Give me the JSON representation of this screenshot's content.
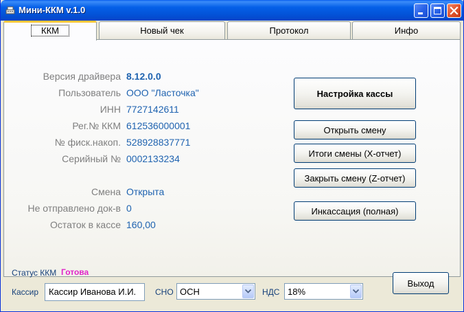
{
  "window": {
    "title": "Мини-ККМ v.1.0"
  },
  "tabs": [
    {
      "label": "ККМ",
      "active": true
    },
    {
      "label": "Новый чек",
      "active": false
    },
    {
      "label": "Протокол",
      "active": false
    },
    {
      "label": "Инфо",
      "active": false
    }
  ],
  "kkm": {
    "driver_version": {
      "label": "Версия драйвера",
      "value": "8.12.0.0"
    },
    "user": {
      "label": "Пользователь",
      "value": "ООО \"Ласточка\""
    },
    "inn": {
      "label": "ИНН",
      "value": "7727142611"
    },
    "reg_number": {
      "label": "Рег.№ ККМ",
      "value": "612536000001"
    },
    "fiscal_number": {
      "label": "№ фиск.накоп.",
      "value": "528928837771"
    },
    "serial_number": {
      "label": "Серийный №",
      "value": "0002133234"
    },
    "shift": {
      "label": "Смена",
      "value": "Открыта"
    },
    "unsent_docs": {
      "label": "Не отправлено док-в",
      "value": "0"
    },
    "cash_balance": {
      "label": "Остаток в кассе",
      "value": "160,00"
    }
  },
  "actions": {
    "settings": "Настройка кассы",
    "open_shift": "Открыть смену",
    "x_report": "Итоги смены (X-отчет)",
    "z_report": "Закрыть смену (Z-отчет)",
    "collection": "Инкассация (полная)"
  },
  "bottom": {
    "status_label": "Статус ККМ",
    "status_value": "Готова",
    "cashier_label": "Кассир",
    "cashier_value": "Кассир Иванова И.И.",
    "sno_label": "СНО",
    "sno_value": "ОСН",
    "nds_label": "НДС",
    "nds_value": "18%",
    "exit_label": "Выход"
  },
  "colors": {
    "title_bar": "#0560e8",
    "value_text": "#1f63b0",
    "label_text": "#7f7f7f",
    "status_ready": "#e025c8",
    "active_tab_highlight": "#ffc83c"
  },
  "icons": {
    "app_icon": "cash-register-icon",
    "minimize": "minimize-icon",
    "maximize": "maximize-icon",
    "close": "close-icon",
    "dropdown": "chevron-down-icon"
  }
}
